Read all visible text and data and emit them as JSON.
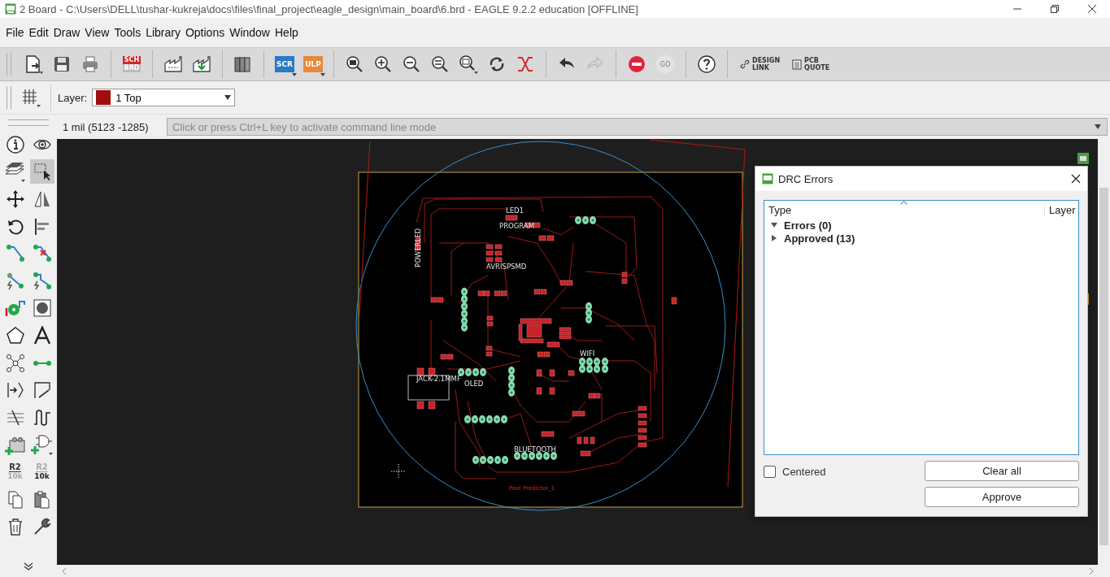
{
  "window": {
    "title": "2 Board - C:\\Users\\DELL\\tushar-kukreja\\docs\\files\\final_project\\eagle_design\\main_board\\6.brd - EAGLE 9.2.2 education [OFFLINE]"
  },
  "menu": [
    "File",
    "Edit",
    "Draw",
    "View",
    "Tools",
    "Library",
    "Options",
    "Window",
    "Help"
  ],
  "toolbar": {
    "sch_brd": [
      "SCH",
      "BRD"
    ],
    "script": "SCR",
    "ulp": "ULP",
    "go": "GO",
    "design_link": [
      "DESIGN",
      "LINK"
    ],
    "pcb_quote": [
      "PCB",
      "QUOTE"
    ]
  },
  "layer_bar": {
    "label": "Layer:",
    "value": "1 Top",
    "color": "#a00d0d"
  },
  "command_line": {
    "coordinates": "1 mil (5123 -1285)",
    "placeholder": "Click or press Ctrl+L key to activate command line mode"
  },
  "side_toolbar": {
    "value_icons": [
      {
        "top": "R2",
        "bottom": "10k"
      },
      {
        "top": "R2",
        "bottom": "10k"
      }
    ]
  },
  "board": {
    "labels": [
      "LED1",
      "PROGRAM",
      "POWERLED",
      "AVRISPSMD",
      "JACK-2.1MMF",
      "OLED",
      "WIFI",
      "BLUETOOTH"
    ],
    "title": "Pest Predictor_1"
  },
  "drc_dialog": {
    "title": "DRC Errors",
    "columns": [
      "Type",
      "Layer"
    ],
    "items": [
      {
        "label": "Errors (0)",
        "expanded": true
      },
      {
        "label": "Approved (13)",
        "expanded": false
      }
    ],
    "centered": {
      "label": "Centered",
      "checked": false
    },
    "buttons": [
      "Clear all",
      "Approve"
    ]
  }
}
